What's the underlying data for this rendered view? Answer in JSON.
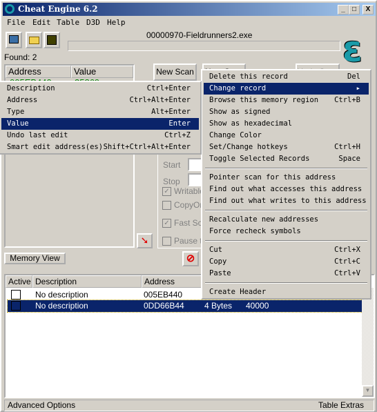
{
  "window": {
    "title": "Cheat Engine 6.2",
    "minimize": "_",
    "maximize": "□",
    "close": "X"
  },
  "menu": [
    "File",
    "Edit",
    "Table",
    "D3D",
    "Help"
  ],
  "toolbar": {
    "icons": [
      "open-process-icon",
      "open-file-icon",
      "save-icon"
    ]
  },
  "process_name": "00000970-Fieldrunners2.exe",
  "found_label": "Found: 2",
  "found_list": {
    "headers": [
      "Address",
      "Value"
    ],
    "rows": [
      {
        "address": "005EB440",
        "value": "35869"
      }
    ],
    "text_color": "#008000"
  },
  "buttons": {
    "new_scan": "New Scan",
    "next_scan": "Next Scan",
    "undo_scan": "Undo Scan",
    "memory_view": "Memory View"
  },
  "scan_options": {
    "start": "Start",
    "stop": "Stop",
    "writable": "Writable",
    "copy_on_write": "CopyOnWrite",
    "fast_scan": "Fast Scan",
    "pause": "Pause the game while scanning"
  },
  "submenu": [
    {
      "label": "Description",
      "shortcut": "Ctrl+Enter"
    },
    {
      "label": "Address",
      "shortcut": "Ctrl+Alt+Enter"
    },
    {
      "label": "Type",
      "shortcut": "Alt+Enter"
    },
    {
      "label": "Value",
      "shortcut": "Enter",
      "highlighted": true
    },
    {
      "label": "Undo last edit",
      "shortcut": "Ctrl+Z"
    },
    {
      "label": "Smart edit address(es)",
      "shortcut": "Shift+Ctrl+Alt+Enter"
    }
  ],
  "context_menu": [
    {
      "label": "Delete this record",
      "shortcut": "Del"
    },
    {
      "label": "Change record",
      "shortcut": "▸",
      "highlighted": true
    },
    {
      "label": "Browse this memory region",
      "shortcut": "Ctrl+B"
    },
    {
      "label": "Show as signed",
      "shortcut": ""
    },
    {
      "label": "Show as hexadecimal",
      "shortcut": ""
    },
    {
      "label": "Change Color",
      "shortcut": ""
    },
    {
      "label": "Set/Change hotkeys",
      "shortcut": "Ctrl+H"
    },
    {
      "label": "Toggle Selected Records",
      "shortcut": "Space"
    },
    {
      "label": "Pointer scan for this address",
      "shortcut": ""
    },
    {
      "label": "Find out what accesses this address",
      "shortcut": ""
    },
    {
      "label": "Find out what writes to this address",
      "shortcut": ""
    },
    {
      "label": "Recalculate new addresses",
      "shortcut": ""
    },
    {
      "label": "Force recheck symbols",
      "shortcut": ""
    },
    {
      "label": "Cut",
      "shortcut": "Ctrl+X"
    },
    {
      "label": "Copy",
      "shortcut": "Ctrl+C"
    },
    {
      "label": "Paste",
      "shortcut": "Ctrl+V"
    },
    {
      "label": "Create Header",
      "shortcut": ""
    }
  ],
  "address_table": {
    "headers": [
      "Active",
      "Description",
      "Address"
    ],
    "rows": [
      {
        "description": "No description",
        "address": "005EB440",
        "type": "",
        "value": ""
      },
      {
        "description": "No description",
        "address": "0DD66B44",
        "type": "4 Bytes",
        "value": "40000",
        "selected": true
      }
    ]
  },
  "status_bar": {
    "left": "Advanced Options",
    "right": "Table Extras"
  },
  "colors": {
    "selection": "#0a246a",
    "logo": "#1a9aa8"
  }
}
